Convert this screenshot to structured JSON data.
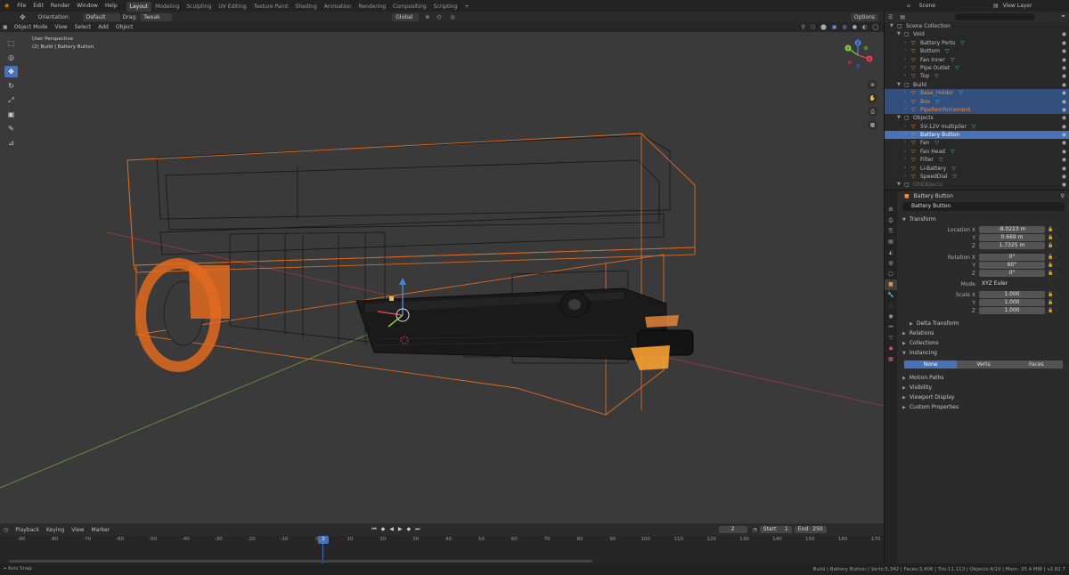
{
  "menu": [
    "File",
    "Edit",
    "Render",
    "Window",
    "Help"
  ],
  "workspaces": [
    "Layout",
    "Modeling",
    "Sculpting",
    "UV Editing",
    "Texture Paint",
    "Shading",
    "Animation",
    "Rendering",
    "Compositing",
    "Scripting"
  ],
  "active_workspace": "Layout",
  "scene_name": "Scene",
  "view_layer": "View Layer",
  "tool_header": {
    "orientation_label": "Orientation:",
    "orientation_value": "Default",
    "drag_label": "Drag:",
    "drag_value": "Tweak",
    "transform_space": "Global",
    "options": "Options"
  },
  "viewport_header": {
    "mode": "Object Mode",
    "menus": [
      "View",
      "Select",
      "Add",
      "Object"
    ]
  },
  "viewport": {
    "perspective": "User Perspective",
    "context": "(2) Build | Battery Button"
  },
  "gizmo": {
    "x": "X",
    "y": "Y",
    "z": "Z"
  },
  "tools": [
    "select-box",
    "cursor",
    "move",
    "rotate",
    "scale",
    "transform",
    "annotate",
    "measure"
  ],
  "outliner": {
    "title": "Scene Collection",
    "rows": [
      {
        "label": "Scene Collection",
        "level": 0,
        "type": "coll",
        "state": ""
      },
      {
        "label": "Void",
        "level": 1,
        "type": "coll",
        "state": ""
      },
      {
        "label": "Battery Ports",
        "level": 2,
        "type": "obj",
        "state": "",
        "mod": true
      },
      {
        "label": "Bottom",
        "level": 2,
        "type": "obj",
        "state": "",
        "mod": true
      },
      {
        "label": "Fan Inner",
        "level": 2,
        "type": "obj",
        "state": "",
        "mod": true
      },
      {
        "label": "Pipe Outlet",
        "level": 2,
        "type": "obj",
        "state": "",
        "mod": true
      },
      {
        "label": "Top",
        "level": 2,
        "type": "obj",
        "state": "",
        "mod": true
      },
      {
        "label": "Build",
        "level": 1,
        "type": "coll",
        "state": ""
      },
      {
        "label": "Base_Holder",
        "level": 2,
        "type": "obj",
        "state": "sel",
        "mod": true
      },
      {
        "label": "Box",
        "level": 2,
        "type": "obj",
        "state": "sel",
        "mod": true
      },
      {
        "label": "PipeReinforcement",
        "level": 2,
        "type": "obj",
        "state": "sel",
        "mod": false
      },
      {
        "label": "Objects",
        "level": 1,
        "type": "coll",
        "state": ""
      },
      {
        "label": "5V-12V multiplier",
        "level": 2,
        "type": "obj",
        "state": "",
        "mod": true
      },
      {
        "label": "Battery Button",
        "level": 2,
        "type": "obj",
        "state": "active",
        "mod": false
      },
      {
        "label": "Fan",
        "level": 2,
        "type": "obj",
        "state": "",
        "mod": true
      },
      {
        "label": "Fan Head",
        "level": 2,
        "type": "obj",
        "state": "",
        "mod": true
      },
      {
        "label": "Filter",
        "level": 2,
        "type": "obj",
        "state": "",
        "mod": true
      },
      {
        "label": "Li-Battery",
        "level": 2,
        "type": "obj",
        "state": "",
        "mod": true
      },
      {
        "label": "SpeedDial",
        "level": 2,
        "type": "obj",
        "state": "",
        "mod": true
      },
      {
        "label": "OldObjects",
        "level": 1,
        "type": "coll",
        "state": "dim"
      }
    ]
  },
  "properties": {
    "header": "Battery Button",
    "object_name": "Battery Button",
    "transform_title": "Transform",
    "location": {
      "label": "Location X",
      "x": "-8.0223 m",
      "y": "0.669 m",
      "z": "1.7325 m"
    },
    "rotation": {
      "label": "Rotation X",
      "x": "0°",
      "y": "60°",
      "z": "0°"
    },
    "mode": {
      "label": "Mode",
      "value": "XYZ Euler"
    },
    "scale": {
      "label": "Scale X",
      "x": "1.000",
      "y": "1.000",
      "z": "1.000"
    },
    "axis": {
      "y": "Y",
      "z": "Z"
    },
    "delta": "Delta Transform",
    "panels": [
      "Relations",
      "Collections",
      "Instancing"
    ],
    "instancing": [
      "None",
      "Verts",
      "Faces"
    ],
    "panels2": [
      "Motion Paths",
      "Visibility",
      "Viewport Display",
      "Custom Properties"
    ]
  },
  "timeline": {
    "menus": [
      "Playback",
      "Keying",
      "View",
      "Marker"
    ],
    "current_frame": "2",
    "start_label": "Start",
    "start": "1",
    "end_label": "End",
    "end": "250",
    "ticks": [
      "-90",
      "-80",
      "-70",
      "-60",
      "-50",
      "-40",
      "-30",
      "-20",
      "-10",
      "0",
      "10",
      "20",
      "30",
      "40",
      "50",
      "60",
      "70",
      "80",
      "90",
      "100",
      "110",
      "120",
      "130",
      "140",
      "150",
      "160",
      "170"
    ]
  },
  "status": {
    "left": "Axis Snap",
    "right": "Build | Battery Button | Verts:5,342 | Faces:3,406 | Tris:11,113 | Objects:4/10 | Mem: 35.4 MiB | v2.82.7"
  },
  "colors": {
    "accent": "#4872b8",
    "selection": "#f08a3c",
    "active_orange": "#ffa033",
    "viewport_bg": "#3a3a3a"
  }
}
